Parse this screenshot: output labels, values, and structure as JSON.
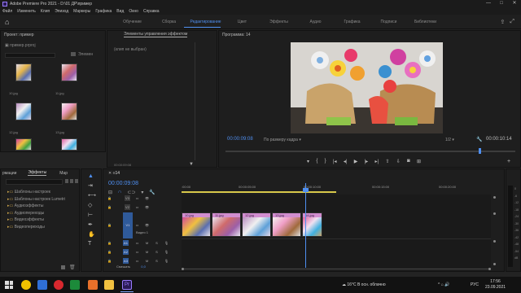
{
  "window": {
    "title": "Adobe Premiere Pro 2021 - D:\\01 ДР\\пример",
    "controls": [
      "—",
      "□",
      "✕"
    ]
  },
  "menu": [
    "Файл",
    "Изменить",
    "Клип",
    "Эпизод",
    "Маркеры",
    "Графика",
    "Вид",
    "Окно",
    "Справка"
  ],
  "workspaces": [
    "Обучение",
    "Сборка",
    "Редактирование",
    "Цвет",
    "Эффекты",
    "Аудио",
    "Графика",
    "Подписи",
    "Библиотеки"
  ],
  "workspace_active": "Редактирование",
  "project_panel": {
    "title": "Проект: пример",
    "file": "пример.prproj",
    "items_label": "Элемен",
    "thumb_labels": [
      "10.jpg",
      "11.jpg",
      "12.jpg",
      "13.jpg"
    ]
  },
  "effect_controls": {
    "title": "Элементы управления эффектом",
    "placeholder": "(клип не выбран)",
    "time": "00:00:09:08"
  },
  "program_monitor": {
    "title": "Программа: 14",
    "timecode": "00:00:09:08",
    "fit": "По размеру кадра",
    "quality": "1/2",
    "duration": "00:00:10:14"
  },
  "effects_panel": {
    "tabs": [
      "рмации",
      "Эффекты",
      "Мар"
    ],
    "items": [
      "Шаблоны настроек",
      "Шаблоны настроек Lumetri",
      "Аудиоэффекты",
      "Аудиопереходы",
      "Видеоэффекты",
      "Видеопереходы"
    ]
  },
  "timeline": {
    "tab": "14",
    "timecode": "00:00:09:08",
    "ruler": [
      ":00:00",
      "00:00:05:00",
      "00:00:10:00",
      "00:00:15:00",
      "00:00:20:00"
    ],
    "tracks_video": [
      "V3",
      "V2",
      "V1"
    ],
    "video_label": "Видео 1",
    "tracks_audio": [
      "A1",
      "A2",
      "A3"
    ],
    "mix_label": "Смешать",
    "mix_value": "0,0",
    "clips": [
      "10.jpg",
      "11.jpg",
      "12.jpg",
      "13.jpg",
      "14.jpg"
    ]
  },
  "meter_labels": [
    "0",
    "-6",
    "-12",
    "-18",
    "-24",
    "-30",
    "-36",
    "-42",
    "-48",
    "-54",
    "dB"
  ],
  "taskbar": {
    "weather": "16°C  В осн. облачно",
    "lang": "РУС",
    "time": "17:56",
    "date": "23.09.2021"
  },
  "colors": {
    "accent": "#4f8ff0",
    "clip_header": "#d18dcf",
    "playhead": "#4f8ff0"
  }
}
